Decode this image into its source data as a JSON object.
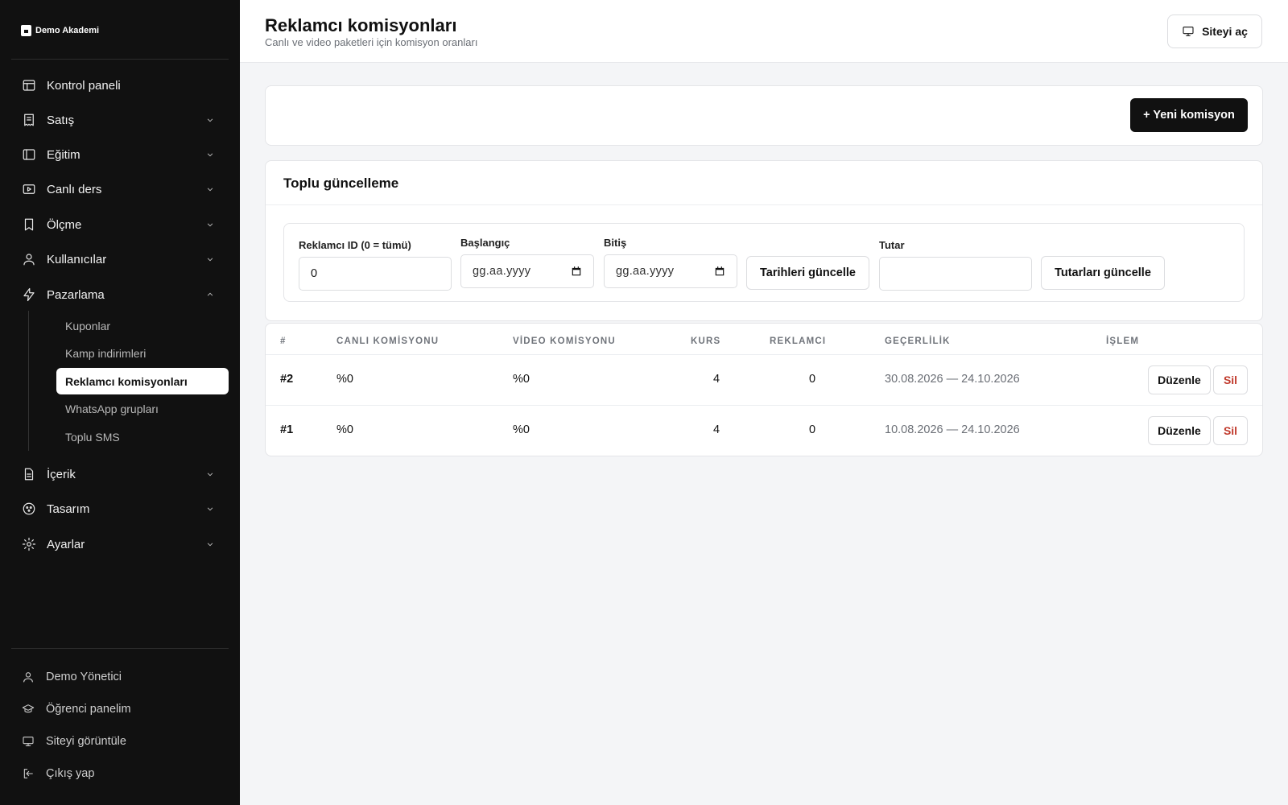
{
  "brand": {
    "name": "Demo Akademi"
  },
  "sidebar": {
    "items": [
      {
        "label": "Kontrol paneli",
        "icon": "layout-icon"
      },
      {
        "label": "Satış",
        "icon": "receipt-icon"
      },
      {
        "label": "Eğitim",
        "icon": "book-panel-icon"
      },
      {
        "label": "Canlı ders",
        "icon": "video-icon"
      },
      {
        "label": "Ölçme",
        "icon": "bookmark-icon"
      },
      {
        "label": "Kullanıcılar",
        "icon": "user-icon"
      },
      {
        "label": "Pazarlama",
        "icon": "bolt-icon"
      },
      {
        "label": "İçerik",
        "icon": "document-icon"
      },
      {
        "label": "Tasarım",
        "icon": "palette-icon"
      },
      {
        "label": "Ayarlar",
        "icon": "gear-icon"
      }
    ],
    "marketing_sub": [
      {
        "label": "Kuponlar"
      },
      {
        "label": "Kamp indirimleri"
      },
      {
        "label": "Reklamcı komisyonları"
      },
      {
        "label": "WhatsApp grupları"
      },
      {
        "label": "Toplu SMS"
      }
    ],
    "footer": [
      {
        "label": "Demo Yönetici",
        "icon": "user-icon"
      },
      {
        "label": "Öğrenci panelim",
        "icon": "graduation-cap-icon"
      },
      {
        "label": "Siteyi görüntüle",
        "icon": "monitor-icon"
      },
      {
        "label": "Çıkış yap",
        "icon": "logout-icon"
      }
    ]
  },
  "header": {
    "title": "Reklamcı komisyonları",
    "subtitle": "Canlı ve video paketleri için komisyon oranları",
    "open_site": "Siteyi aç"
  },
  "actions": {
    "new_commission": "+ Yeni komisyon"
  },
  "bulk": {
    "title": "Toplu güncelleme",
    "advertiser_label": "Reklamcı ID (0 = tümü)",
    "advertiser_value": "0",
    "start_label": "Başlangıç",
    "start_placeholder": "gg.aa.yyyy",
    "end_label": "Bitiş",
    "end_placeholder": "gg.aa.yyyy",
    "update_dates": "Tarihleri güncelle",
    "amount_label": "Tutar",
    "amount_value": "",
    "update_amounts": "Tutarları güncelle"
  },
  "table": {
    "headers": [
      "#",
      "CANLI KOMİSYONU",
      "VİDEO KOMİSYONU",
      "KURS",
      "REKLAMCI",
      "GEÇERLİLİK",
      "İŞLEM"
    ],
    "rows": [
      {
        "id": "#2",
        "live": "%0",
        "video": "%0",
        "course": "4",
        "advertiser": "0",
        "validity": "30.08.2026 — 24.10.2026"
      },
      {
        "id": "#1",
        "live": "%0",
        "video": "%0",
        "course": "4",
        "advertiser": "0",
        "validity": "10.08.2026 — 24.10.2026"
      }
    ],
    "edit_label": "Düzenle",
    "delete_label": "Sil"
  },
  "colors": {
    "sidebar_bg": "#111111",
    "accent": "#111111",
    "danger": "#c0392b",
    "page_bg": "#f4f5f7"
  }
}
